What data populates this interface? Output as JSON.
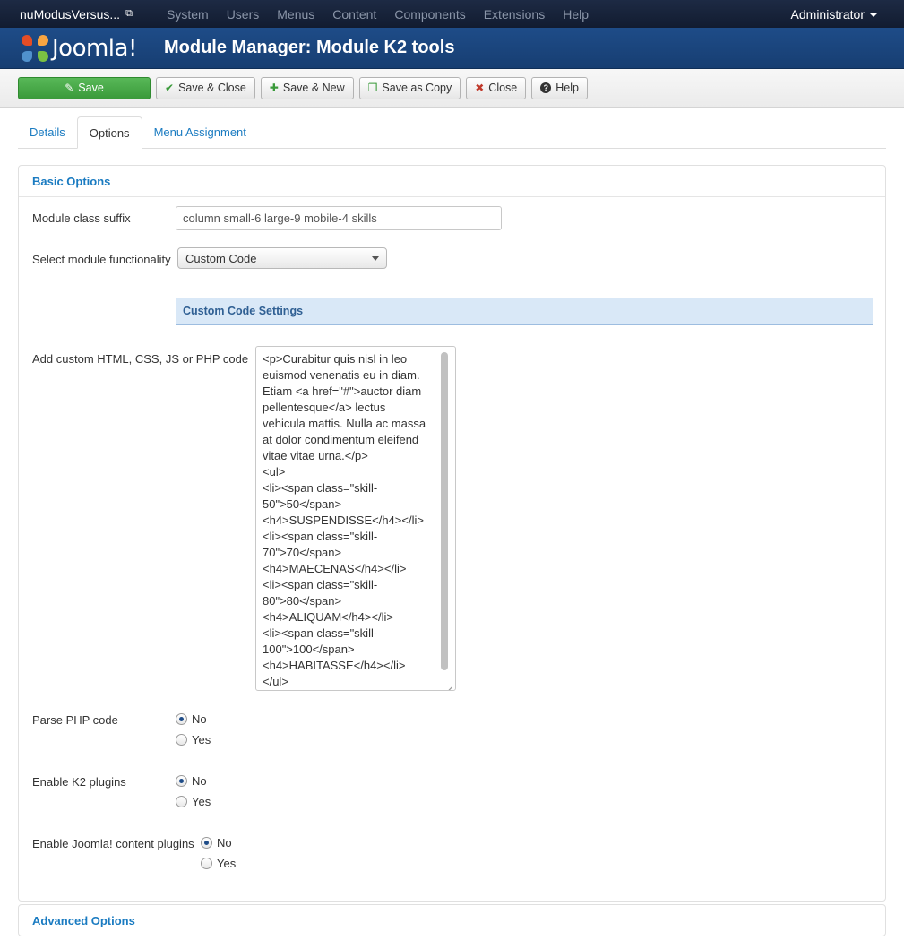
{
  "topnav": {
    "site_name": "nuModusVersus...",
    "menu": [
      "System",
      "Users",
      "Menus",
      "Content",
      "Components",
      "Extensions",
      "Help"
    ],
    "user": "Administrator"
  },
  "header": {
    "logo_text": "Joomla!",
    "title": "Module Manager: Module K2 tools"
  },
  "toolbar": {
    "save": "Save",
    "save_close": "Save & Close",
    "save_new": "Save & New",
    "save_copy": "Save as Copy",
    "close": "Close",
    "help": "Help"
  },
  "tabs": [
    "Details",
    "Options",
    "Menu Assignment"
  ],
  "basic_options": {
    "title": "Basic Options",
    "class_suffix_label": "Module class suffix",
    "class_suffix_value": "column small-6 large-9 mobile-4 skills",
    "functionality_label": "Select module functionality",
    "functionality_value": "Custom Code",
    "custom_code_heading": "Custom Code Settings",
    "code_label": "Add custom HTML, CSS, JS or PHP code",
    "code_lines": [
      "<p>Curabitur quis nisl in leo",
      "euismod venenatis eu in diam.",
      "Etiam <a href=\"#\">auctor diam",
      "pellentesque</a> lectus",
      "vehicula mattis. Nulla ac massa",
      "at dolor condimentum eleifend",
      "vitae vitae urna.</p>",
      "<ul>",
      "<li><span class=\"skill-",
      "50\">50</span>",
      "<h4>SUSPENDISSE</h4></li>",
      "<li><span class=\"skill-",
      "70\">70</span>",
      "<h4>MAECENAS</h4></li>",
      "<li><span class=\"skill-",
      "80\">80</span>",
      "<h4>ALIQUAM</h4></li>",
      "<li><span class=\"skill-",
      "100\">100</span>",
      "<h4>HABITASSE</h4></li>",
      "</ul>"
    ],
    "parse_php_label": "Parse PHP code",
    "k2_plugins_label": "Enable K2 plugins",
    "joomla_plugins_label": "Enable Joomla! content plugins",
    "no": "No",
    "yes": "Yes"
  },
  "advanced_options": {
    "title": "Advanced Options"
  },
  "colors": {
    "topnav": "#17233a",
    "header": "#1e4c88",
    "save_button": "#46a546",
    "link": "#1a7bc1"
  }
}
